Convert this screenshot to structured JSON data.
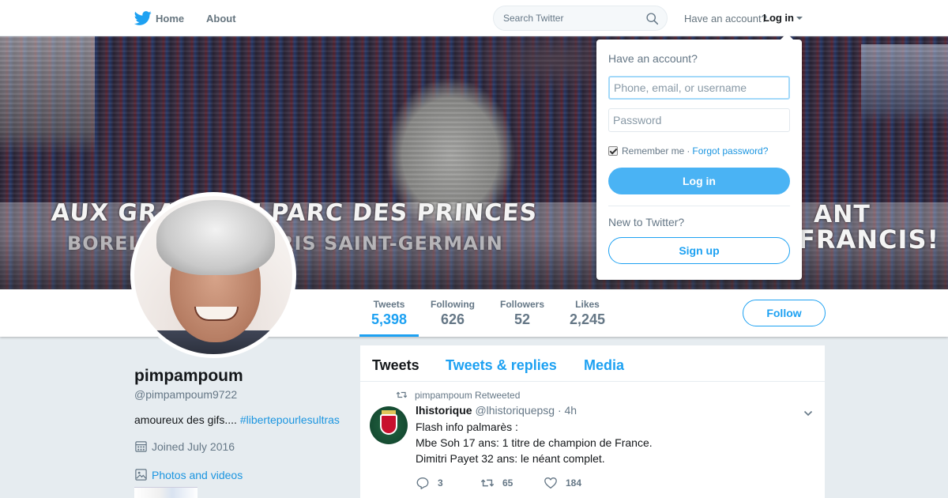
{
  "nav": {
    "home_label": "Home",
    "about_label": "About",
    "search_placeholder": "Search Twitter",
    "have_account": "Have an account?",
    "login_label": "Log in"
  },
  "banner": {
    "text_line1": "AUX GRA      ES LE PARC DES PRINCES",
    "text_line1_right": "ANT",
    "text_line2": "BORELLI       ON DU PARIS SAINT-GERMAIN",
    "text_line2_right": "FRANCIS!"
  },
  "profile": {
    "name": "pimpampoum",
    "handle": "@pimpampoum9722",
    "bio_text": "amoureux des gifs....",
    "bio_hashtag": "#libertepourlesultras",
    "joined": "Joined July 2016",
    "photos_label": "Photos and videos"
  },
  "stats": [
    {
      "label": "Tweets",
      "value": "5,398"
    },
    {
      "label": "Following",
      "value": "626"
    },
    {
      "label": "Followers",
      "value": "52"
    },
    {
      "label": "Likes",
      "value": "2,245"
    }
  ],
  "follow_label": "Follow",
  "timeline": {
    "tabs": [
      "Tweets",
      "Tweets & replies",
      "Media"
    ],
    "tweet": {
      "retweet_context": "pimpampoum Retweeted",
      "author": "lhistorique",
      "handle": "@lhistoriquepsg",
      "time": "· 4h",
      "lines": [
        "Flash info palmarès :",
        "Mbe Soh 17 ans: 1 titre de champion de France.",
        "Dimitri Payet 32 ans: le néant complet."
      ],
      "replies": "3",
      "retweets": "65",
      "likes": "184"
    }
  },
  "login_dropdown": {
    "title": "Have an account?",
    "username_placeholder": "Phone, email, or username",
    "password_placeholder": "Password",
    "remember_label": "Remember me",
    "separator": "·",
    "forgot_label": "Forgot password?",
    "login_button": "Log in",
    "new_label": "New to Twitter?",
    "signup_button": "Sign up"
  },
  "colors": {
    "accent": "#1da1f2",
    "link": "#1b95e0",
    "login_button_bg": "#4ab3f4"
  }
}
